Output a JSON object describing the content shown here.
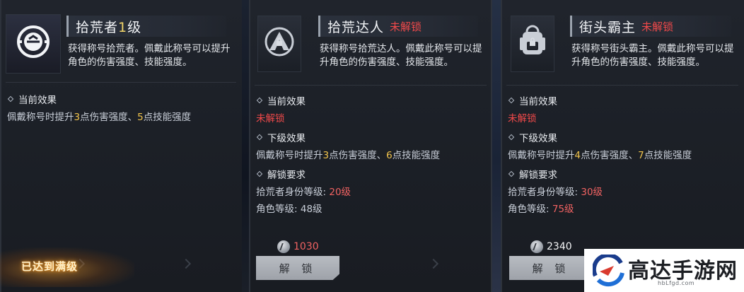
{
  "cards": [
    {
      "title": "拾荒者",
      "title_level": "1",
      "title_suffix": "级",
      "description": "获得称号拾荒者。佩戴此称号可以提升角色的伤害强度、技能强度。",
      "current_effect_heading": "当前效果",
      "current_effect": {
        "prefix": "佩戴称号时提升",
        "v1": "3",
        "mid": "点伤害强度、",
        "v2": "5",
        "suffix": "点技能强度"
      },
      "badge": "已达到满级"
    },
    {
      "title": "拾荒达人",
      "locked_tag": "未解锁",
      "description": "获得称号拾荒达人。佩戴此称号可以提升角色的伤害强度、技能强度。",
      "current_effect_heading": "当前效果",
      "current_effect_value": "未解锁",
      "next_effect_heading": "下级效果",
      "next_effect": {
        "prefix": "佩戴称号时提升",
        "v1": "3",
        "mid": "点伤害强度、",
        "v2": "6",
        "suffix": "点技能强度"
      },
      "requirement_heading": "解锁要求",
      "req_identity_label": "拾荒者身份等级:",
      "req_identity_value": "20级",
      "req_role_label": "角色等级:",
      "req_role_value": "48级",
      "cost": "1030",
      "unlock_button": "解 锁"
    },
    {
      "title": "街头霸主",
      "locked_tag": "未解锁",
      "description": "获得称号街头霸主。佩戴此称号可以提升角色的伤害强度、技能强度。",
      "current_effect_heading": "当前效果",
      "current_effect_value": "未解锁",
      "next_effect_heading": "下级效果",
      "next_effect": {
        "prefix": "佩戴称号时提升",
        "v1": "4",
        "mid": "点伤害强度、",
        "v2": "7",
        "suffix": "点技能强度"
      },
      "requirement_heading": "解锁要求",
      "req_identity_label": "拾荒者身份等级:",
      "req_identity_value": "30级",
      "req_role_label": "角色等级:",
      "req_role_value": "75级",
      "cost": "2340",
      "unlock_button": "解 锁"
    }
  ],
  "watermark": {
    "name": "高达手游网",
    "url": "hbLfgd.com"
  },
  "colors": {
    "accent_gold": "#f2c44c",
    "locked_red": "#f0494a",
    "panel_bg": "#1c2027"
  }
}
